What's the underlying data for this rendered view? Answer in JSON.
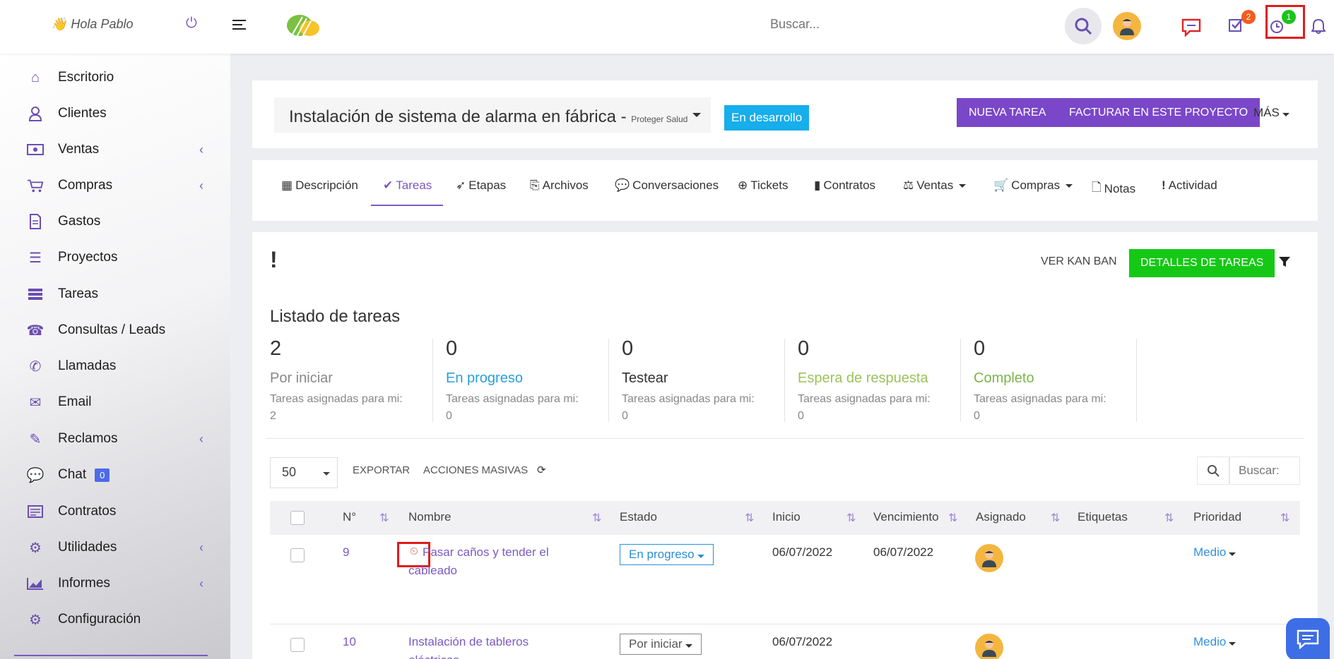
{
  "topbar": {
    "greeting": "Hola Pablo",
    "search_placeholder": "Buscar...",
    "tasks_badge": "2",
    "timer_badge": "1"
  },
  "sidebar": {
    "items": [
      {
        "label": "Escritorio",
        "icon": "home-icon"
      },
      {
        "label": "Clientes",
        "icon": "user-icon"
      },
      {
        "label": "Ventas",
        "icon": "money-icon"
      },
      {
        "label": "Compras",
        "icon": "cart-icon"
      },
      {
        "label": "Gastos",
        "icon": "file-icon"
      },
      {
        "label": "Proyectos",
        "icon": "bars-icon"
      },
      {
        "label": "Tareas",
        "icon": "tasks-icon"
      },
      {
        "label": "Consultas / Leads",
        "icon": "phone-icon"
      },
      {
        "label": "Llamadas",
        "icon": "call-icon"
      },
      {
        "label": "Email",
        "icon": "envelope-icon"
      },
      {
        "label": "Reclamos",
        "icon": "ticket-icon"
      },
      {
        "label": "Chat",
        "icon": "chat-icon",
        "count": "0"
      },
      {
        "label": "Contratos",
        "icon": "contract-icon"
      },
      {
        "label": "Utilidades",
        "icon": "cogs-icon"
      },
      {
        "label": "Informes",
        "icon": "chart-icon"
      },
      {
        "label": "Configuración",
        "icon": "gear-icon"
      }
    ]
  },
  "project": {
    "title": "Instalación de sistema de alarma en fábrica - ",
    "client": "Proteger Salud",
    "status": "En desarrollo",
    "new_task": "NUEVA TAREA",
    "invoice": "FACTURAR EN ESTE PROYECTO",
    "more": "MÁS"
  },
  "tabs": [
    "Descripción",
    "Tareas",
    "Etapas",
    "Archivos",
    "Conversaciones",
    "Tickets",
    "Contratos",
    "Ventas",
    "Compras",
    "Notas",
    "Actividad"
  ],
  "tasks": {
    "exclaim": "!",
    "kanban": "VER KAN BAN",
    "details": "DETALLES DE TAREAS",
    "list_title": "Listado de tareas",
    "stats": [
      {
        "count": "2",
        "label": "Por iniciar",
        "sub": "Tareas asignadas para mi:",
        "mine": "2",
        "color": "#888888"
      },
      {
        "count": "0",
        "label": "En progreso",
        "sub": "Tareas asignadas para mi:",
        "mine": "0",
        "color": "#2b9fd8"
      },
      {
        "count": "0",
        "label": "Testear",
        "sub": "Tareas asignadas para mi:",
        "mine": "0",
        "color": "#333333"
      },
      {
        "count": "0",
        "label": "Espera de respuesta",
        "sub": "Tareas asignadas para mi:",
        "mine": "0",
        "color": "#9bc25a"
      },
      {
        "count": "0",
        "label": "Completo",
        "sub": "Tareas asignadas para mi:",
        "mine": "0",
        "color": "#7ab648"
      }
    ],
    "page_length": "50",
    "export": "EXPORTAR",
    "bulk": "ACCIONES MASIVAS",
    "search_placeholder": "Buscar:",
    "columns": [
      "N°",
      "Nombre",
      "Estado",
      "Inicio",
      "Vencimiento",
      "Asignado",
      "Etiquetas",
      "Prioridad"
    ],
    "rows": [
      {
        "num": "9",
        "name_a": "Pasar caños y tender el",
        "name_b": "cableado",
        "status": "En progreso",
        "start": "06/07/2022",
        "due": "06/07/2022",
        "priority": "Medio"
      },
      {
        "num": "10",
        "name_a": "Instalación de tableros",
        "name_b": "eléctricos",
        "status": "Por iniciar",
        "start": "06/07/2022",
        "due": "",
        "priority": "Medio"
      }
    ]
  }
}
